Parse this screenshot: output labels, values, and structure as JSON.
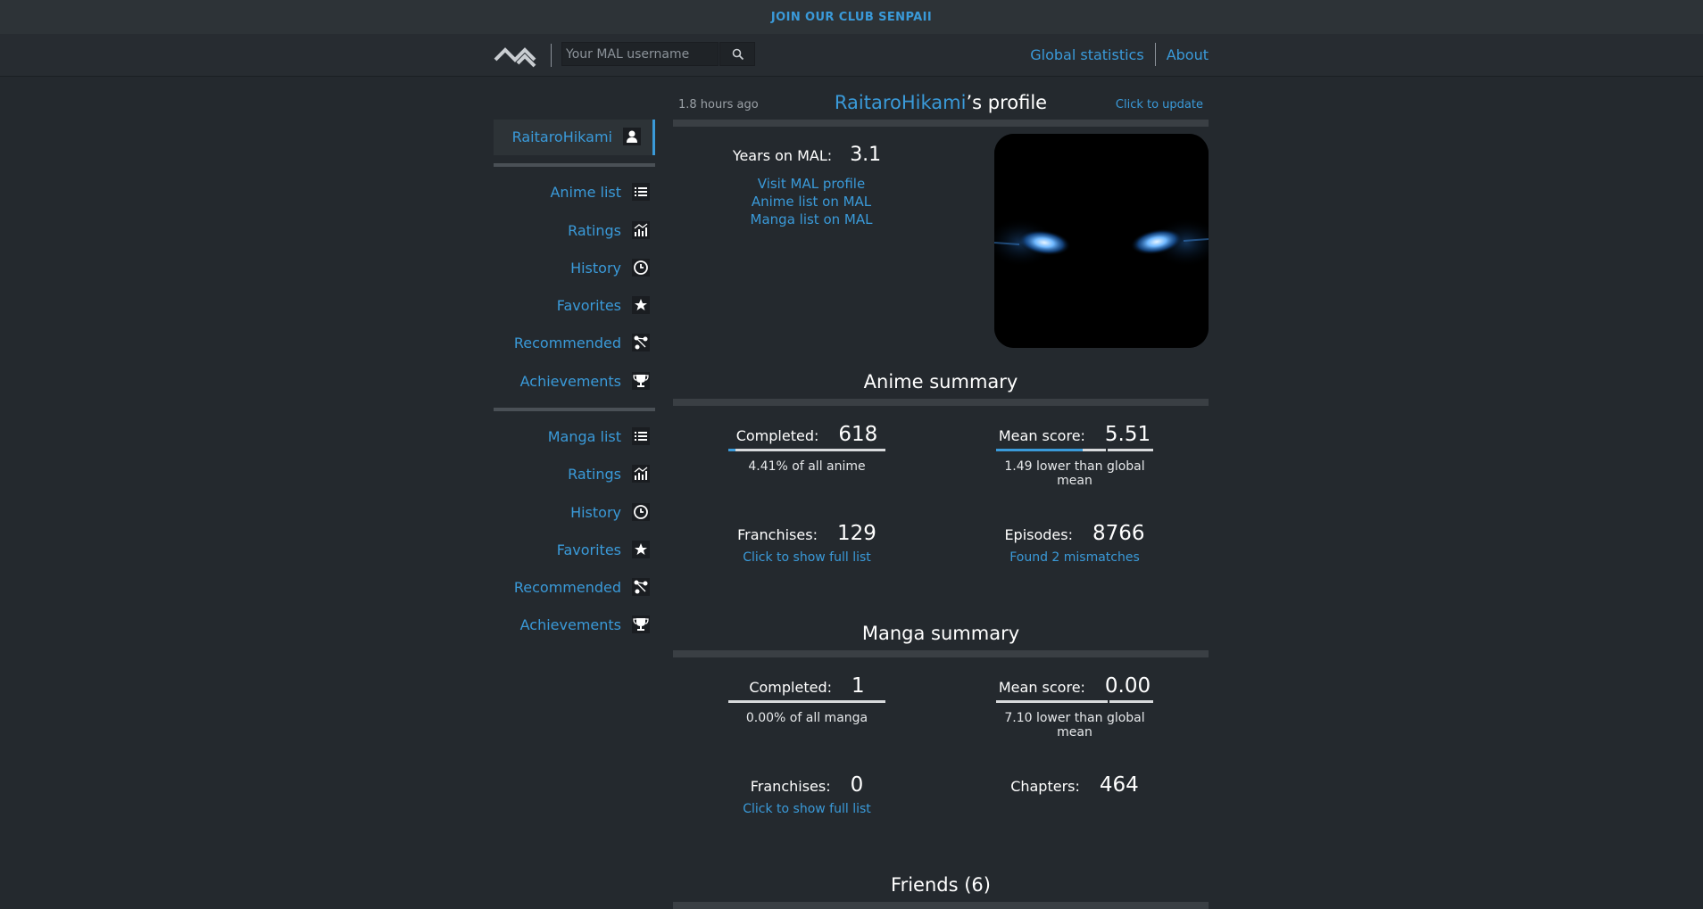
{
  "banner": {
    "text": "JOIN OUR CLUB SENPAII"
  },
  "nav": {
    "search_placeholder": "Your MAL username",
    "links": [
      "Global statistics",
      "About"
    ]
  },
  "sidebar": {
    "user": "RaitaroHikami",
    "anime_items": [
      "Anime list",
      "Ratings",
      "History",
      "Favorites",
      "Recommended",
      "Achievements"
    ],
    "manga_items": [
      "Manga list",
      "Ratings",
      "History",
      "Favorites",
      "Recommended",
      "Achievements"
    ]
  },
  "profile": {
    "updated": "1.8 hours ago",
    "username": "RaitaroHikami",
    "title_suffix": "’s profile",
    "update_link": "Click to update",
    "years_label": "Years on MAL:",
    "years_value": "3.1",
    "links": [
      "Visit MAL profile",
      "Anime list on MAL",
      "Manga list on MAL"
    ]
  },
  "anime_summary": {
    "title": "Anime summary",
    "completed_label": "Completed:",
    "completed_value": "618",
    "completed_fraction": 0.0441,
    "completed_sub": "4.41% of all anime",
    "mean_label": "Mean score:",
    "mean_value": "5.51",
    "mean_fraction": 0.551,
    "mean_sub": "1.49 lower than global mean",
    "franchises_label": "Franchises:",
    "franchises_value": "129",
    "franchises_link": "Click to show full list",
    "episodes_label": "Episodes:",
    "episodes_value": "8766",
    "episodes_link": "Found 2 mismatches"
  },
  "manga_summary": {
    "title": "Manga summary",
    "completed_label": "Completed:",
    "completed_value": "1",
    "completed_fraction": 0.0,
    "completed_sub": "0.00% of all manga",
    "mean_label": "Mean score:",
    "mean_value": "0.00",
    "mean_fraction": 0.0,
    "mean_sub": "7.10 lower than global mean",
    "franchises_label": "Franchises:",
    "franchises_value": "0",
    "franchises_link": "Click to show full list",
    "chapters_label": "Chapters:",
    "chapters_value": "464"
  },
  "friends": {
    "title": "Friends (6)"
  },
  "colors": {
    "accent": "#3a9ad9",
    "background": "#24292e",
    "banner": "#2d3337"
  }
}
